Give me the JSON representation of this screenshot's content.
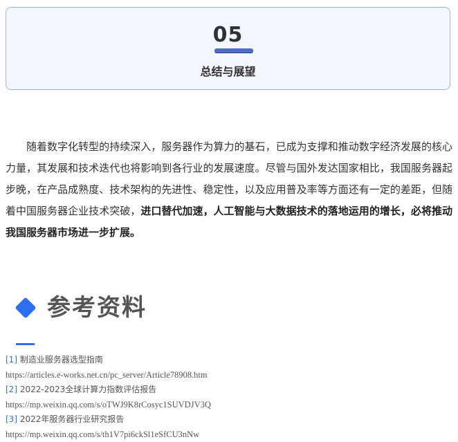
{
  "section": {
    "number": "05",
    "title": "总结与展望"
  },
  "summary": {
    "text_plain": "随着数字化转型的持续深入，服务器作为算力的基石，已成为支撑和推动数字经济发展的核心力量，其发展和技术迭代也将影响到各行业的发展速度。尽管与国外发达国家相比，我国服务器起步晚，在产品成熟度、技术架构的先进性、稳定性，以及应用普及率等方面还有一定的差距，但随着中国服务器企业技术突破，",
    "text_bold": "进口替代加速，人工智能与大数据技术的落地运用的增长，必将推动我国服务器市场进一步扩展。"
  },
  "references": {
    "heading": "参考资料",
    "items": [
      {
        "index": "[1]",
        "title": "制造业服务器选型指南",
        "url": "https://articles.e-works.net.cn/pc_server/Article78908.htm"
      },
      {
        "index": "[2]",
        "title": "2022-2023全球计算力指数评估报告",
        "url": "https://mp.weixin.qq.com/s/oTWJ9K8rCosyc1SUVDJV3Q"
      },
      {
        "index": "[3]",
        "title": "2022年服务器行业研究报告",
        "url": "https://mp.weixin.qq.com/s/th1V7pi6ckSl1eSfCU3nNw"
      }
    ]
  },
  "colors": {
    "accent": "#2d6ff0",
    "card_border": "#9bb3e8",
    "card_background": "#f4f7fd",
    "number_underline": "#4b6cc9"
  }
}
